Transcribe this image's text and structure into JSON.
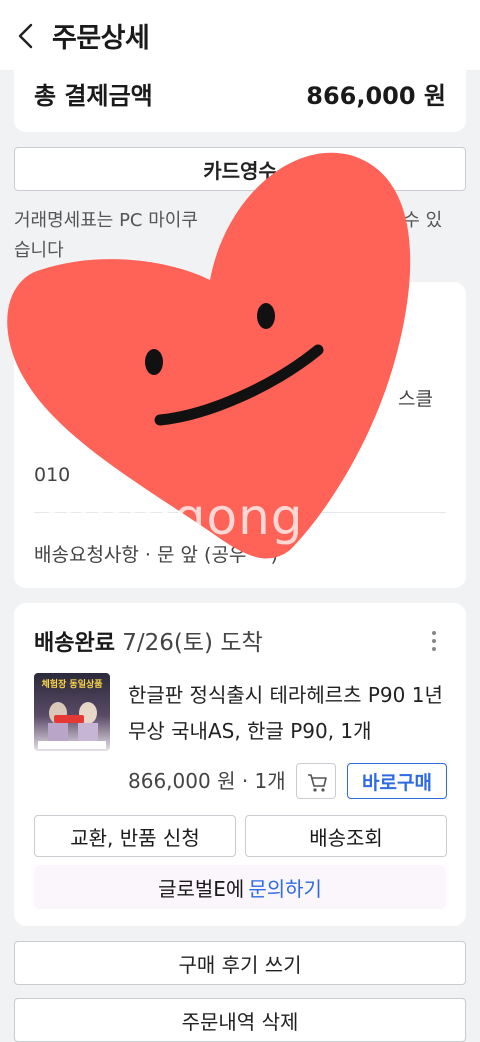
{
  "header": {
    "title": "주문상세",
    "back_icon": "chevron-left-icon"
  },
  "payment": {
    "total_label": "총 결제금액",
    "total_value": "866,000 원"
  },
  "receipt": {
    "button_label": "카드영수",
    "note_line1": "거래명세표는 PC 마이쿠",
    "note_line1_tail": "할 수 있",
    "note_line2": "습니다"
  },
  "address": {
    "line_a": "스클",
    "phone_partial": "010",
    "request_label": "배송요청사항 · 문 앞 (공우 ···)"
  },
  "delivery": {
    "status": "배송완료",
    "date": " 7/26(토) 도착",
    "more_icon": "more-vertical-icon",
    "product_name": "한글판 정식출시 테라헤르츠 P90 1년무상 국내AS, 한글 P90, 1개",
    "price": "866,000 원 · 1개",
    "cart_icon": "cart-icon",
    "buy_label": "바로구매",
    "return_label": "교환, 반품 신청",
    "track_label": "배송조회",
    "inquiry_prefix": "글로벌E에",
    "inquiry_link": "문의하기",
    "thumb_text": "체험장 동일상품"
  },
  "actions": {
    "review_label": "구매 후기 쓰기",
    "delete_label": "주문내역 삭제"
  },
  "overlay": {
    "watermark": "bonggong"
  },
  "colors": {
    "accent": "#2d6ae3",
    "sticker": "#ff6257",
    "background": "#f1f2f4"
  }
}
